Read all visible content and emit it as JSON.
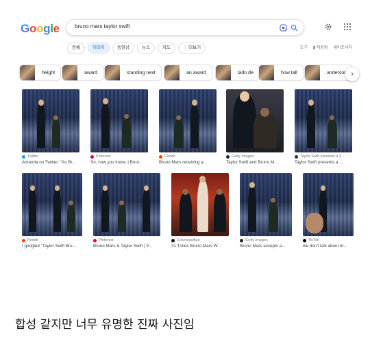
{
  "logo": [
    "G",
    "o",
    "o",
    "g",
    "l",
    "e"
  ],
  "search": {
    "query": "bruno mars taylor swift"
  },
  "tabs": [
    {
      "label": "전체",
      "active": false
    },
    {
      "label": "이미지",
      "active": true
    },
    {
      "label": "동영상",
      "active": false
    },
    {
      "label": "뉴스",
      "active": false
    },
    {
      "label": "지도",
      "active": false
    },
    {
      "label": "⋮ 더보기",
      "active": false
    }
  ],
  "tools": {
    "tools_label": "도구",
    "saved_label": "저장됨",
    "safesearch_label": "세이프서치"
  },
  "chips": [
    "height",
    "award",
    "standing next",
    "an award",
    "lado de",
    "how tall",
    "anderson"
  ],
  "results": [
    {
      "source": "Twitter",
      "color": "#1d9bf0",
      "title": "Amanda on Twitter: \"As Br..."
    },
    {
      "source": "Pinterest",
      "color": "#e60023",
      "title": "So, now you know. | Brun..."
    },
    {
      "source": "Reddit",
      "color": "#ff4500",
      "title": "Bruno Mars receiving a..."
    },
    {
      "source": "Getty Images",
      "color": "#222222",
      "title": "Taylor Swift and Bruno M..."
    },
    {
      "source": "Taylor Swift presents a V...",
      "color": "#333333",
      "title": "Taylor Swift presents a ..."
    },
    {
      "source": "Reddit",
      "color": "#ff4500",
      "title": "I googled \"Taylor Swift Bru..."
    },
    {
      "source": "Pinterest",
      "color": "#e60023",
      "title": "Bruno Mars & Taylor Swift | P..."
    },
    {
      "source": "Cosmopolitan",
      "color": "#111111",
      "title": "31 Times Bruno Mars W..."
    },
    {
      "source": "Getty Images",
      "color": "#222222",
      "title": "Bruno Mars accepts a..."
    },
    {
      "source": "TikTok",
      "color": "#000000",
      "title": "we don't talk about br..."
    }
  ],
  "caption": "합성 같지만 너무 유명한 진짜 사진임"
}
